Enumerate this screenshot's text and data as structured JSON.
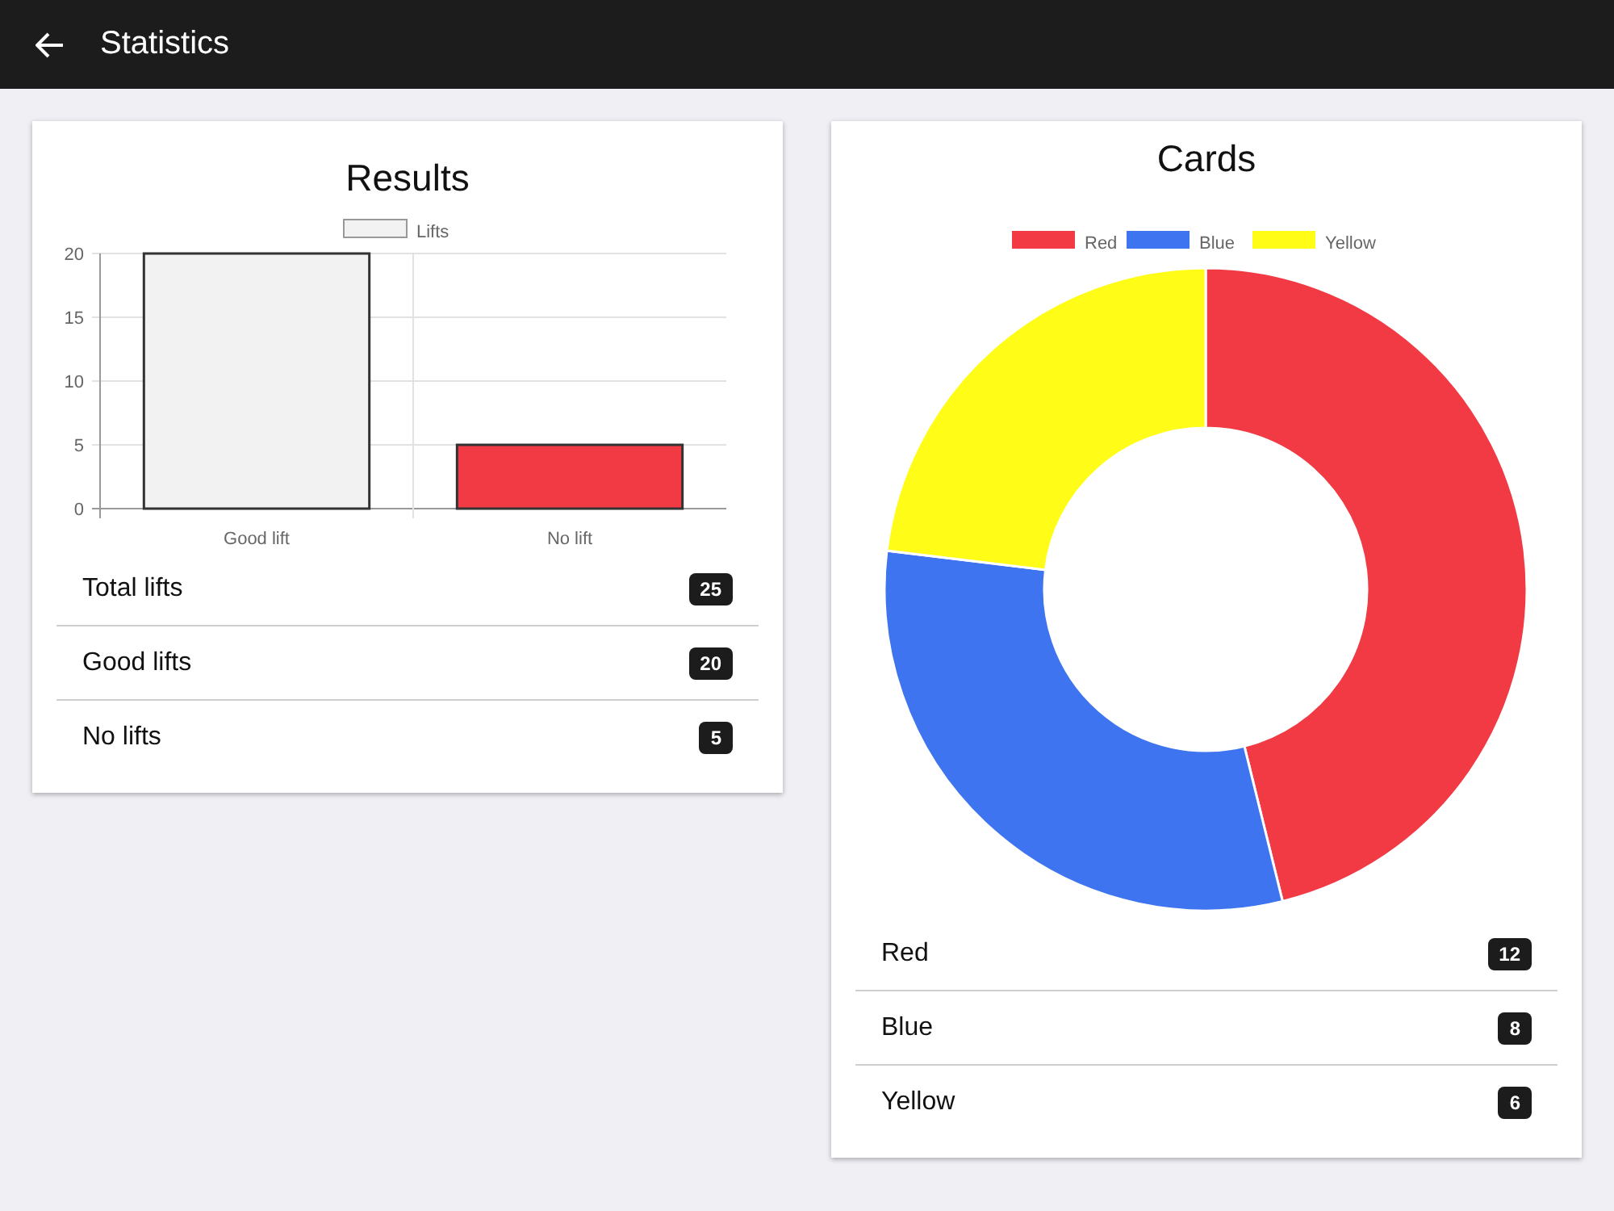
{
  "app_bar": {
    "title": "Statistics"
  },
  "results": {
    "title": "Results",
    "chart_data": {
      "type": "bar",
      "categories": [
        "Good lift",
        "No lift"
      ],
      "series": [
        {
          "name": "Lifts",
          "values": [
            20,
            5
          ]
        }
      ],
      "colors": [
        "#f2f2f2",
        "#f23a44"
      ],
      "ylim": [
        0,
        20
      ],
      "yticks": [
        0,
        5,
        10,
        15,
        20
      ],
      "grid": true,
      "legend": "top"
    },
    "rows": [
      {
        "label": "Total lifts",
        "count": "25"
      },
      {
        "label": "Good lifts",
        "count": "20"
      },
      {
        "label": "No lifts",
        "count": "5"
      }
    ]
  },
  "cards": {
    "title": "Cards",
    "chart_data": {
      "type": "donut",
      "categories": [
        "Red",
        "Blue",
        "Yellow"
      ],
      "values": [
        46.15,
        30.77,
        23.08
      ],
      "colors": [
        "#f23a44",
        "#3e74f0",
        "#fffd18"
      ],
      "legend": "top"
    },
    "rows": [
      {
        "label": "Red",
        "count": "12"
      },
      {
        "label": "Blue",
        "count": "8"
      },
      {
        "label": "Yellow",
        "count": "6"
      }
    ]
  }
}
